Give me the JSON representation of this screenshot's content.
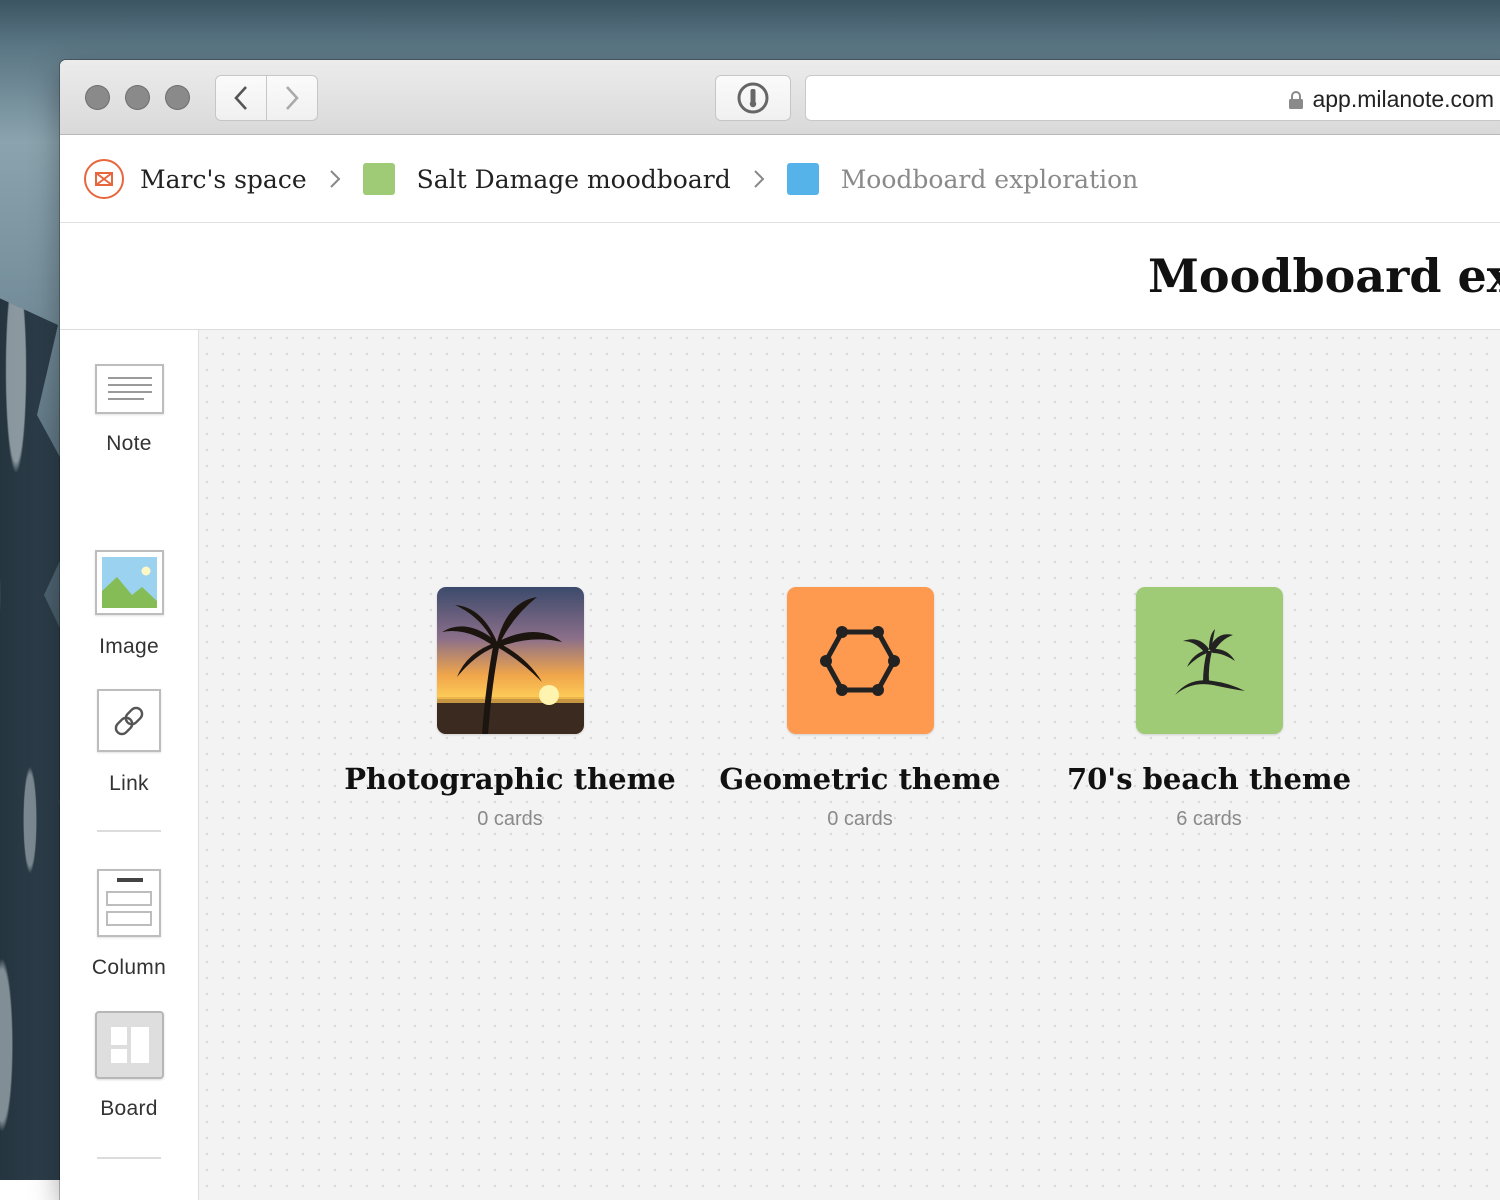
{
  "browser": {
    "url": "app.milanote.com"
  },
  "breadcrumb": {
    "items": [
      {
        "label": "Marc's space"
      },
      {
        "label": "Salt Damage moodboard",
        "color": "#a0cb76"
      },
      {
        "label": "Moodboard exploration",
        "color": "#56b3ea"
      }
    ]
  },
  "board": {
    "title": "Moodboard exploration"
  },
  "toolbar": {
    "tools": [
      {
        "label": "Note",
        "icon": "note-icon"
      },
      {
        "label": "Image",
        "icon": "image-icon"
      },
      {
        "label": "Link",
        "icon": "link-icon"
      },
      {
        "label": "Column",
        "icon": "column-icon"
      },
      {
        "label": "Board",
        "icon": "board-icon"
      },
      {
        "icon": "arrow-icon"
      }
    ]
  },
  "cards": [
    {
      "title": "Photographic theme",
      "count": "0 cards",
      "icon": "palm-sunset-photo"
    },
    {
      "title": "Geometric theme",
      "count": "0 cards",
      "icon": "hexagon-icon",
      "color": "#fd9a50"
    },
    {
      "title": "70's beach theme",
      "count": "6 cards",
      "icon": "palm-island-icon",
      "color": "#a0cb76"
    }
  ],
  "colors": {
    "accent": "#e8663d",
    "canvas": "#f3f3f3"
  }
}
